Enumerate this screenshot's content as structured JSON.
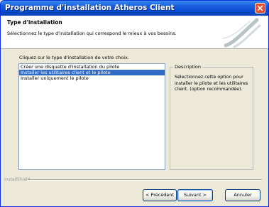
{
  "window": {
    "title": "Programme d'installation Atheros Client"
  },
  "header": {
    "title": "Type d'installation",
    "subtitle": "Sélectionnez le type d'installation qui correspond le mieux à vos besoins."
  },
  "main": {
    "instruction": "Cliquez sur le type d'installation de votre choix.",
    "options": [
      {
        "label": "Créer une disquette d'installation du pilote",
        "selected": false
      },
      {
        "label": "Installer les utilitaires client et le pilote",
        "selected": true
      },
      {
        "label": "Installer uniquement le pilote",
        "selected": false
      }
    ],
    "description": {
      "legend": "Description",
      "text": "Sélectionnez cette option pour installer le pilote et les utilitaires client. (option recommandée)."
    }
  },
  "footer": {
    "brand": "InstallShield",
    "back_label": "< Précédent",
    "next_label": "Suivant >",
    "cancel_label": "Annuler"
  },
  "colors": {
    "titlebar": "#0a4ad0",
    "selection": "#316ac5",
    "close": "#e24a2b"
  },
  "icons": {
    "close": "close-icon",
    "header_graphic": "installer-swirl-icon"
  }
}
